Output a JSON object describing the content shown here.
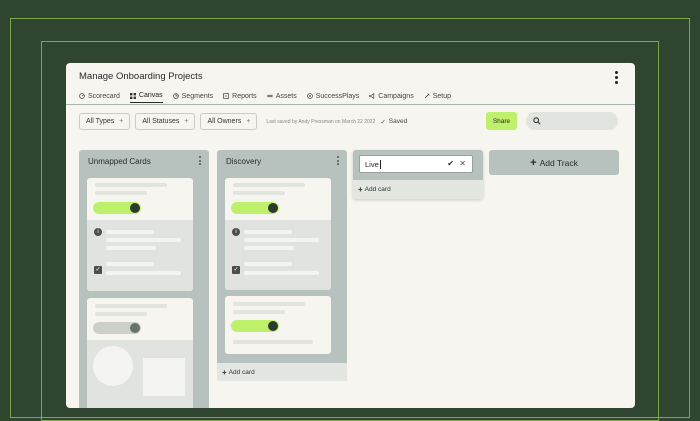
{
  "app": {
    "title": "Manage Onboarding Projects"
  },
  "tabs": [
    {
      "label": "Scorecard",
      "icon": "scorecard-icon",
      "active": false
    },
    {
      "label": "Canvas",
      "icon": "canvas-icon",
      "active": true
    },
    {
      "label": "Segments",
      "icon": "segments-icon",
      "active": false
    },
    {
      "label": "Reports",
      "icon": "reports-icon",
      "active": false
    },
    {
      "label": "Assets",
      "icon": "assets-icon",
      "active": false
    },
    {
      "label": "SuccessPlays",
      "icon": "successplays-icon",
      "active": false
    },
    {
      "label": "Campaigns",
      "icon": "campaigns-icon",
      "active": false
    },
    {
      "label": "Setup",
      "icon": "setup-icon",
      "active": false
    }
  ],
  "filters": {
    "types": "All Types",
    "statuses": "All Statuses",
    "owners": "All Owners",
    "plus": "+",
    "last_saved": "Last saved by Andy Pressman on March 22 2022",
    "saved": "Saved",
    "saved_icon": "✓"
  },
  "share_label": "Share",
  "search": {
    "value": ""
  },
  "columns": {
    "unmapped": {
      "title": "Unmapped Cards"
    },
    "discovery": {
      "title": "Discovery",
      "add_card": "Add card"
    }
  },
  "new_track": {
    "value": "Live",
    "confirm_icon": "✔",
    "cancel_icon": "✕",
    "add_card": "Add card"
  },
  "add_track_label": "Add Track",
  "plus_glyph": "+",
  "glyphs": {
    "info": "i",
    "check": "✓"
  },
  "colors": {
    "background": "#2f4530",
    "accent": "#bff06b",
    "track": "#b7c1be",
    "panel": "#f7f5ef"
  }
}
